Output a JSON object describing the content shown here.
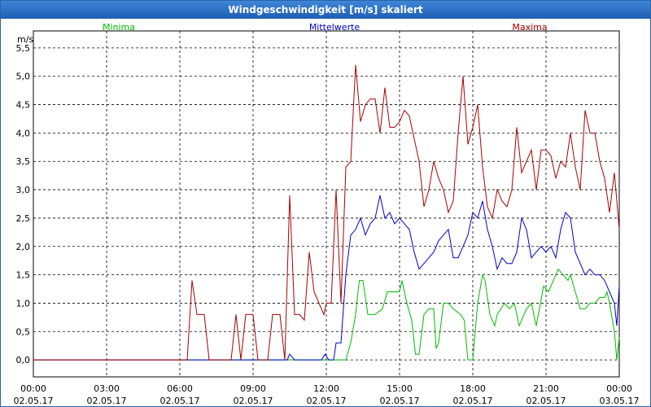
{
  "window": {
    "title": "Windgeschwindigkeit [m/s] skaliert"
  },
  "chart_data": {
    "type": "line",
    "title": "Windgeschwindigkeit [m/s] skaliert",
    "ylabel": "m/s",
    "ylim": [
      -0.3,
      5.8
    ],
    "xlim_hours": [
      0,
      24
    ],
    "grid": true,
    "yticks": [
      "0,0",
      "0,5",
      "1,0",
      "1,5",
      "2,0",
      "2,5",
      "3,0",
      "3,5",
      "4,0",
      "4,5",
      "5,0",
      "5,5"
    ],
    "xticks": [
      {
        "time": "00:00",
        "date": "02.05.17"
      },
      {
        "time": "03:00",
        "date": "02.05.17"
      },
      {
        "time": "06:00",
        "date": "02.05.17"
      },
      {
        "time": "09:00",
        "date": "02.05.17"
      },
      {
        "time": "12:00",
        "date": "02.05.17"
      },
      {
        "time": "15:00",
        "date": "02.05.17"
      },
      {
        "time": "18:00",
        "date": "02.05.17"
      },
      {
        "time": "21:00",
        "date": "02.05.17"
      },
      {
        "time": "00:00",
        "date": "03.05.17"
      }
    ],
    "legend_placement": "top",
    "series": [
      {
        "name": "Minima",
        "color": "#00bb00",
        "points": [
          [
            0,
            0
          ],
          [
            11.9,
            0
          ],
          [
            12.4,
            0
          ],
          [
            12.8,
            0
          ],
          [
            13.0,
            0.3
          ],
          [
            13.2,
            0.8
          ],
          [
            13.35,
            1.4
          ],
          [
            13.5,
            1.4
          ],
          [
            13.7,
            0.8
          ],
          [
            14.0,
            0.8
          ],
          [
            14.3,
            0.9
          ],
          [
            14.5,
            1.2
          ],
          [
            14.8,
            1.2
          ],
          [
            15.0,
            1.2
          ],
          [
            15.1,
            1.4
          ],
          [
            15.3,
            1.0
          ],
          [
            15.5,
            0.7
          ],
          [
            15.65,
            0.1
          ],
          [
            15.8,
            0.1
          ],
          [
            16.0,
            0.8
          ],
          [
            16.2,
            0.9
          ],
          [
            16.4,
            0.9
          ],
          [
            16.5,
            0.2
          ],
          [
            16.6,
            0.3
          ],
          [
            16.8,
            1.0
          ],
          [
            17.0,
            1.0
          ],
          [
            17.2,
            0.9
          ],
          [
            17.5,
            0.8
          ],
          [
            17.65,
            0.7
          ],
          [
            17.8,
            0.0
          ],
          [
            18.0,
            0.0
          ],
          [
            18.2,
            1.0
          ],
          [
            18.4,
            1.5
          ],
          [
            18.5,
            1.4
          ],
          [
            18.7,
            0.8
          ],
          [
            18.9,
            0.6
          ],
          [
            19.0,
            0.8
          ],
          [
            19.3,
            1.0
          ],
          [
            19.5,
            0.9
          ],
          [
            19.7,
            1.0
          ],
          [
            19.9,
            0.6
          ],
          [
            20.2,
            0.9
          ],
          [
            20.4,
            1.0
          ],
          [
            20.6,
            0.6
          ],
          [
            20.9,
            1.3
          ],
          [
            21.1,
            1.2
          ],
          [
            21.3,
            1.4
          ],
          [
            21.5,
            1.6
          ],
          [
            21.7,
            1.5
          ],
          [
            21.9,
            1.4
          ],
          [
            22.0,
            1.5
          ],
          [
            22.2,
            1.2
          ],
          [
            22.4,
            0.9
          ],
          [
            22.6,
            0.9
          ],
          [
            22.8,
            1.0
          ],
          [
            23.0,
            1.0
          ],
          [
            23.2,
            1.1
          ],
          [
            23.4,
            1.1
          ],
          [
            23.5,
            1.2
          ],
          [
            23.6,
            1.0
          ],
          [
            23.8,
            0.5
          ],
          [
            23.9,
            0.0
          ],
          [
            24.0,
            0.4
          ]
        ]
      },
      {
        "name": "Mittelwerte",
        "color": "#0000cc",
        "points": [
          [
            0,
            0
          ],
          [
            10.2,
            0
          ],
          [
            10.4,
            0
          ],
          [
            10.5,
            0.1
          ],
          [
            10.7,
            0
          ],
          [
            11.8,
            0
          ],
          [
            11.95,
            0.1
          ],
          [
            12.1,
            0
          ],
          [
            12.3,
            0
          ],
          [
            12.4,
            0.3
          ],
          [
            12.6,
            0.3
          ],
          [
            12.8,
            1.5
          ],
          [
            13.0,
            2.2
          ],
          [
            13.2,
            2.3
          ],
          [
            13.4,
            2.5
          ],
          [
            13.6,
            2.2
          ],
          [
            13.8,
            2.4
          ],
          [
            14.0,
            2.5
          ],
          [
            14.2,
            2.9
          ],
          [
            14.4,
            2.5
          ],
          [
            14.6,
            2.6
          ],
          [
            14.8,
            2.4
          ],
          [
            15.0,
            2.5
          ],
          [
            15.2,
            2.4
          ],
          [
            15.4,
            2.3
          ],
          [
            15.6,
            1.9
          ],
          [
            15.8,
            1.6
          ],
          [
            16.0,
            1.7
          ],
          [
            16.2,
            1.8
          ],
          [
            16.4,
            1.9
          ],
          [
            16.6,
            2.1
          ],
          [
            16.8,
            2.2
          ],
          [
            17.0,
            2.3
          ],
          [
            17.2,
            1.8
          ],
          [
            17.4,
            1.8
          ],
          [
            17.6,
            2.0
          ],
          [
            17.8,
            2.2
          ],
          [
            18.0,
            2.6
          ],
          [
            18.2,
            2.5
          ],
          [
            18.4,
            2.8
          ],
          [
            18.6,
            2.3
          ],
          [
            18.8,
            2.0
          ],
          [
            19.0,
            1.6
          ],
          [
            19.2,
            1.8
          ],
          [
            19.4,
            1.7
          ],
          [
            19.6,
            1.7
          ],
          [
            19.8,
            1.9
          ],
          [
            20.0,
            2.5
          ],
          [
            20.2,
            2.3
          ],
          [
            20.4,
            1.8
          ],
          [
            20.6,
            1.9
          ],
          [
            20.8,
            2.0
          ],
          [
            21.0,
            1.9
          ],
          [
            21.2,
            2.0
          ],
          [
            21.4,
            1.8
          ],
          [
            21.6,
            2.3
          ],
          [
            21.8,
            2.6
          ],
          [
            22.0,
            2.5
          ],
          [
            22.2,
            1.9
          ],
          [
            22.4,
            1.7
          ],
          [
            22.6,
            1.5
          ],
          [
            22.8,
            1.6
          ],
          [
            23.0,
            1.5
          ],
          [
            23.2,
            1.5
          ],
          [
            23.4,
            1.4
          ],
          [
            23.6,
            1.2
          ],
          [
            23.8,
            1.0
          ],
          [
            23.9,
            0.6
          ],
          [
            24.0,
            1.3
          ]
        ]
      },
      {
        "name": "Maxima",
        "color": "#aa0000",
        "points": [
          [
            0,
            0
          ],
          [
            6.3,
            0
          ],
          [
            6.5,
            1.4
          ],
          [
            6.7,
            0.8
          ],
          [
            7.0,
            0.8
          ],
          [
            7.2,
            0
          ],
          [
            8.1,
            0
          ],
          [
            8.3,
            0.8
          ],
          [
            8.5,
            0
          ],
          [
            8.7,
            0.8
          ],
          [
            9.0,
            0.8
          ],
          [
            9.2,
            0
          ],
          [
            9.6,
            0
          ],
          [
            9.8,
            0.8
          ],
          [
            10.1,
            0.8
          ],
          [
            10.3,
            0
          ],
          [
            10.5,
            2.9
          ],
          [
            10.7,
            0.8
          ],
          [
            10.9,
            0.8
          ],
          [
            11.1,
            0.7
          ],
          [
            11.3,
            1.9
          ],
          [
            11.5,
            1.2
          ],
          [
            11.7,
            1.0
          ],
          [
            11.9,
            0.8
          ],
          [
            12.0,
            1.0
          ],
          [
            12.2,
            1.0
          ],
          [
            12.4,
            3.0
          ],
          [
            12.6,
            1.0
          ],
          [
            12.8,
            3.4
          ],
          [
            13.0,
            3.5
          ],
          [
            13.2,
            5.2
          ],
          [
            13.4,
            4.2
          ],
          [
            13.6,
            4.5
          ],
          [
            13.8,
            4.6
          ],
          [
            14.0,
            4.6
          ],
          [
            14.2,
            4.0
          ],
          [
            14.4,
            4.8
          ],
          [
            14.6,
            4.1
          ],
          [
            14.8,
            4.1
          ],
          [
            15.0,
            4.2
          ],
          [
            15.2,
            4.4
          ],
          [
            15.4,
            4.3
          ],
          [
            15.6,
            3.9
          ],
          [
            15.8,
            3.5
          ],
          [
            16.0,
            2.7
          ],
          [
            16.2,
            3.0
          ],
          [
            16.4,
            3.5
          ],
          [
            16.6,
            3.2
          ],
          [
            16.8,
            3.0
          ],
          [
            17.0,
            2.6
          ],
          [
            17.2,
            2.8
          ],
          [
            17.4,
            4.0
          ],
          [
            17.6,
            5.0
          ],
          [
            17.8,
            3.8
          ],
          [
            18.0,
            4.1
          ],
          [
            18.2,
            4.5
          ],
          [
            18.4,
            3.4
          ],
          [
            18.6,
            2.7
          ],
          [
            18.8,
            2.5
          ],
          [
            19.0,
            3.0
          ],
          [
            19.2,
            2.8
          ],
          [
            19.4,
            2.7
          ],
          [
            19.6,
            3.0
          ],
          [
            19.8,
            4.1
          ],
          [
            20.0,
            3.3
          ],
          [
            20.2,
            3.5
          ],
          [
            20.4,
            3.7
          ],
          [
            20.6,
            3.0
          ],
          [
            20.8,
            3.7
          ],
          [
            21.0,
            3.7
          ],
          [
            21.2,
            3.6
          ],
          [
            21.4,
            3.2
          ],
          [
            21.6,
            3.5
          ],
          [
            21.8,
            3.4
          ],
          [
            22.0,
            4.0
          ],
          [
            22.2,
            3.4
          ],
          [
            22.4,
            3.0
          ],
          [
            22.6,
            4.4
          ],
          [
            22.8,
            4.0
          ],
          [
            23.0,
            4.0
          ],
          [
            23.2,
            3.5
          ],
          [
            23.4,
            3.2
          ],
          [
            23.6,
            2.6
          ],
          [
            23.8,
            3.3
          ],
          [
            24.0,
            2.3
          ]
        ]
      }
    ]
  }
}
